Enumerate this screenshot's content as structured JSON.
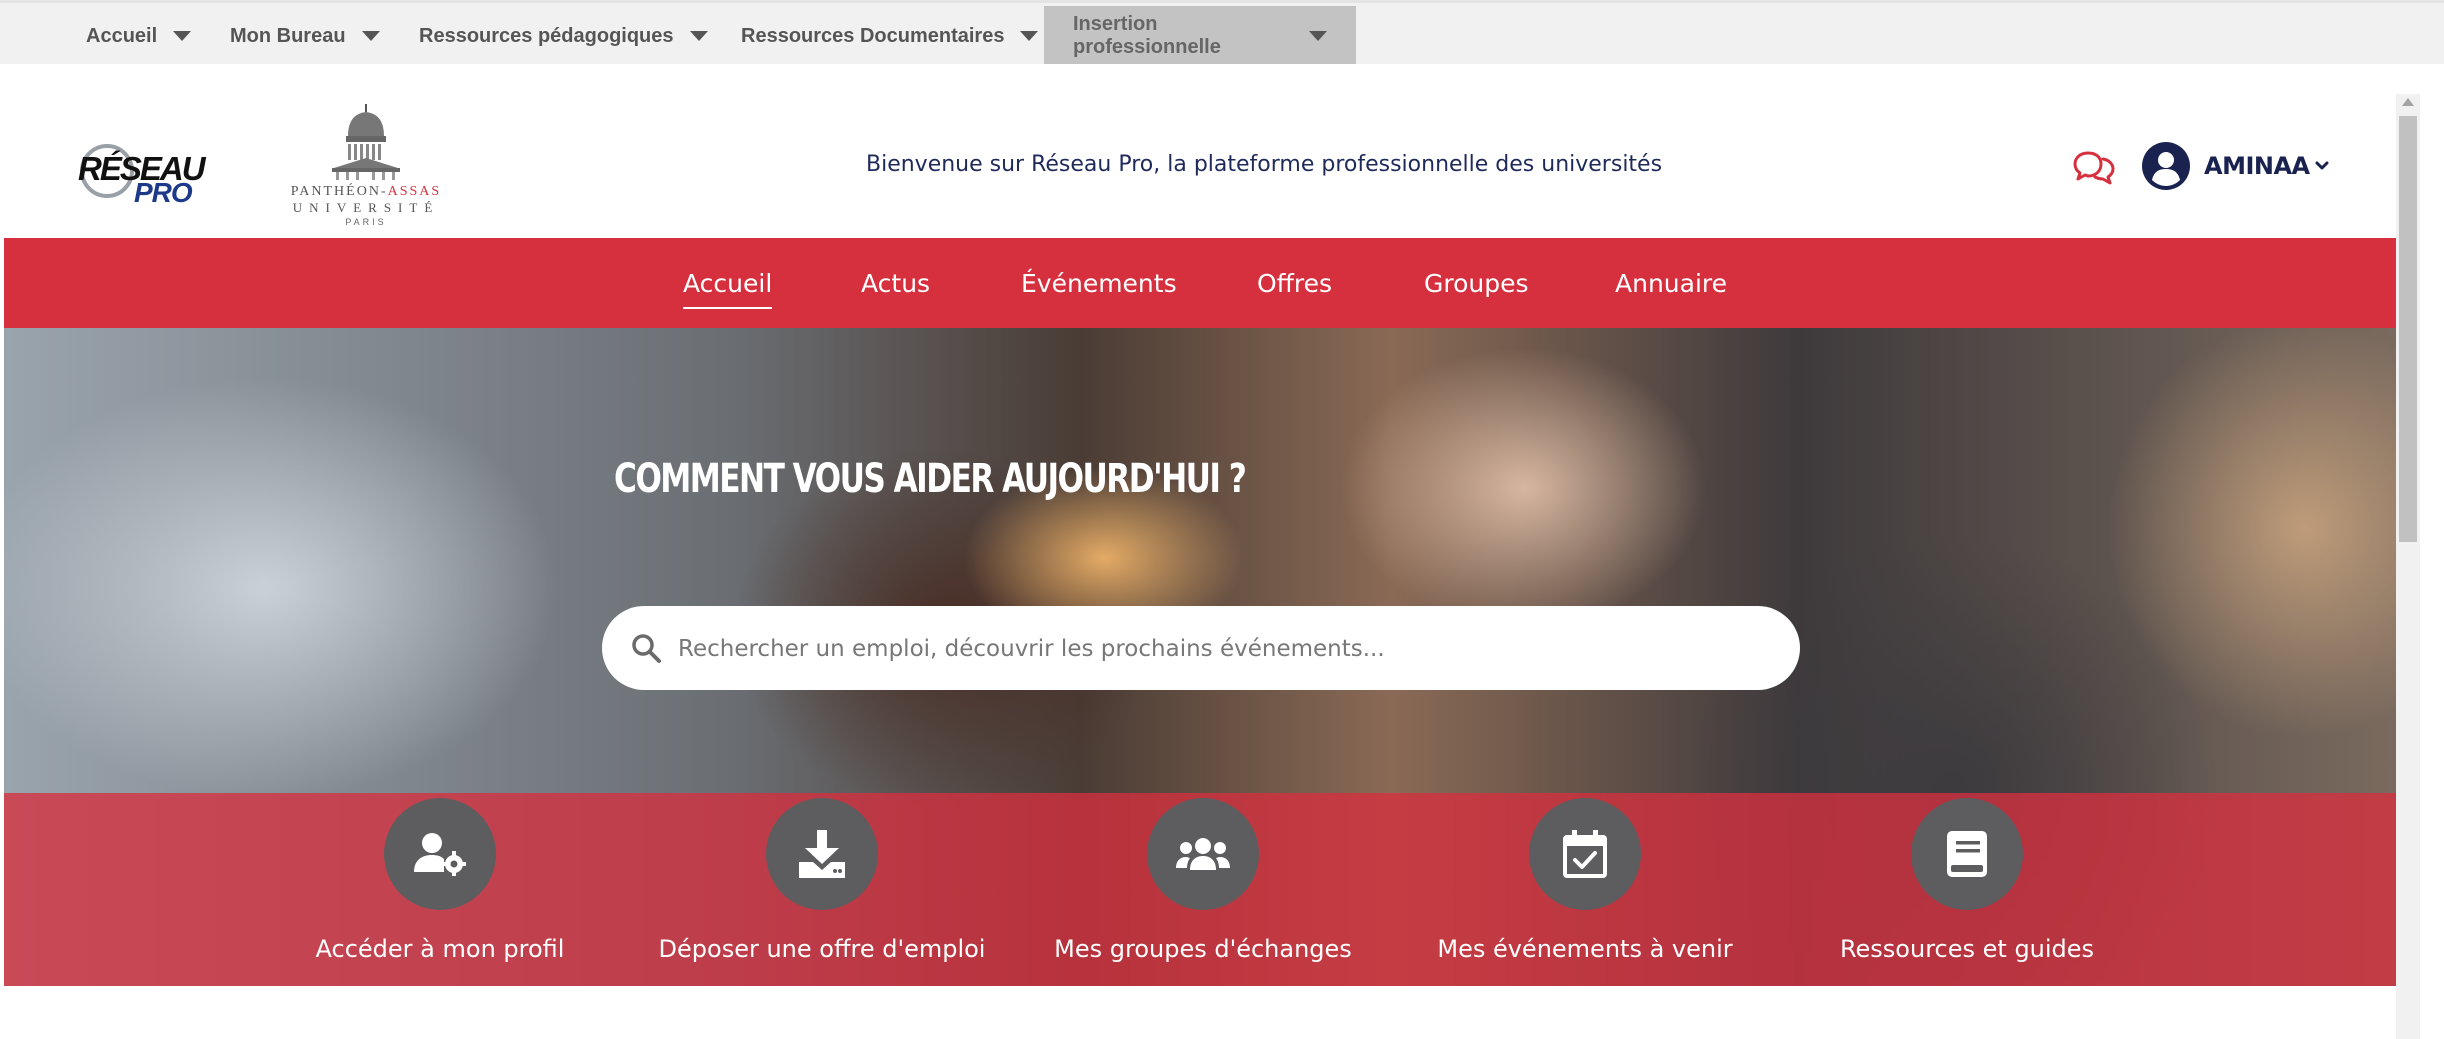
{
  "topnav": {
    "items": [
      {
        "label": "Accueil"
      },
      {
        "label": "Mon Bureau"
      },
      {
        "label": "Ressources pédagogiques"
      },
      {
        "label": "Ressources Documentaires"
      },
      {
        "label": "Insertion professionnelle"
      }
    ]
  },
  "header": {
    "logo_reseau": {
      "line1": "RÉSEAU",
      "line2": "PRO"
    },
    "logo_university": {
      "line1_a": "PANTHÉON-",
      "line1_b": "ASSAS",
      "line2": "UNIVERSITÉ",
      "line3": "PARIS"
    },
    "welcome_text": "Bienvenue sur Réseau Pro, la plateforme professionnelle des universités",
    "user_name": "AMINAA"
  },
  "mainnav": {
    "items": [
      {
        "label": "Accueil"
      },
      {
        "label": "Actus"
      },
      {
        "label": "Événements"
      },
      {
        "label": "Offres"
      },
      {
        "label": "Groupes"
      },
      {
        "label": "Annuaire"
      }
    ],
    "active": "Accueil"
  },
  "hero": {
    "title": "COMMENT VOUS AIDER AUJOURD'HUI ?",
    "search_placeholder": "Rechercher un emploi, découvrir les prochains événements...",
    "shortcuts": [
      {
        "label": "Accéder à mon profil",
        "icon": "user-gear-icon"
      },
      {
        "label": "Déposer une offre d'emploi",
        "icon": "download-icon"
      },
      {
        "label": "Mes groupes d'échanges",
        "icon": "users-group-icon"
      },
      {
        "label": "Mes événements à venir",
        "icon": "calendar-check-icon"
      },
      {
        "label": "Ressources et guides",
        "icon": "book-icon"
      }
    ]
  },
  "colors": {
    "brand_red": "#d6303f",
    "topnav_bg": "#f1f1f1",
    "topnav_active_bg": "#c3c3c3",
    "shortcut_bubble": "#5d5d5f",
    "text_navy": "#1f2a5a"
  }
}
